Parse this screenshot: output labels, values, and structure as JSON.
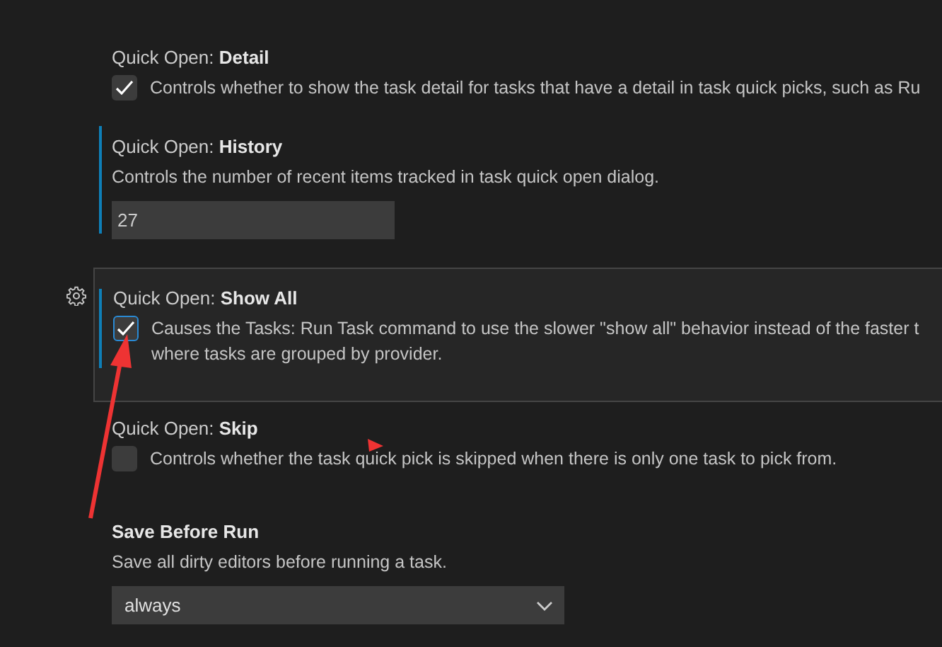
{
  "settings": [
    {
      "kind": "checkbox",
      "category": "Quick Open: ",
      "name": "Detail",
      "lines": [
        "Controls whether to show the task detail for tasks that have a detail in task quick picks, such as Ru"
      ],
      "checked": true,
      "modified": false,
      "selected": false
    },
    {
      "kind": "number",
      "category": "Quick Open: ",
      "name": "History",
      "lines": [
        "Controls the number of recent items tracked in task quick open dialog."
      ],
      "value": "27",
      "modified": true,
      "selected": false
    },
    {
      "kind": "checkbox",
      "category": "Quick Open: ",
      "name": "Show All",
      "lines": [
        "Causes the Tasks: Run Task command to use the slower \"show all\" behavior instead of the faster t",
        "where tasks are grouped by provider."
      ],
      "checked": true,
      "modified": true,
      "selected": true
    },
    {
      "kind": "checkbox",
      "category": "Quick Open: ",
      "name": "Skip",
      "lines": [
        "Controls whether the task quick pick is skipped when there is only one task to pick from."
      ],
      "checked": false,
      "modified": false,
      "selected": false
    },
    {
      "kind": "select",
      "name": "Save Before Run",
      "lines": [
        "Save all dirty editors before running a task."
      ],
      "value": "always",
      "modified": false,
      "selected": false
    }
  ]
}
